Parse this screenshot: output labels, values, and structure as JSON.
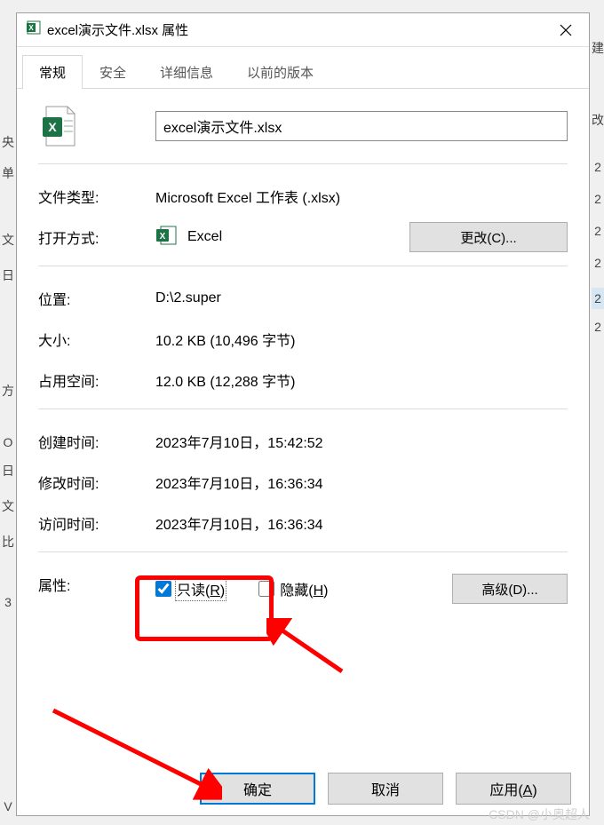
{
  "titlebar": {
    "title": "excel演示文件.xlsx 属性"
  },
  "tabs": {
    "general": "常规",
    "security": "安全",
    "details": "详细信息",
    "previous": "以前的版本"
  },
  "general": {
    "filename": "excel演示文件.xlsx",
    "filetype_label": "文件类型:",
    "filetype_value": "Microsoft Excel 工作表 (.xlsx)",
    "openwith_label": "打开方式:",
    "openwith_app": "Excel",
    "change_btn": "更改(C)...",
    "location_label": "位置:",
    "location_value": "D:\\2.super",
    "size_label": "大小:",
    "size_value": "10.2 KB (10,496 字节)",
    "sizeondisk_label": "占用空间:",
    "sizeondisk_value": "12.0 KB (12,288 字节)",
    "created_label": "创建时间:",
    "created_value": "2023年7月10日，15:42:52",
    "modified_label": "修改时间:",
    "modified_value": "2023年7月10日，16:36:34",
    "accessed_label": "访问时间:",
    "accessed_value": "2023年7月10日，16:36:34",
    "attrs_label": "属性:",
    "readonly_text": "只读(",
    "readonly_key": "R",
    "readonly_close": ")",
    "hidden_text": "隐藏(",
    "hidden_key": "H",
    "hidden_close": ")",
    "advanced_btn": "高级(D)..."
  },
  "footer": {
    "ok": "确定",
    "cancel": "取消",
    "apply_text": "应用(",
    "apply_key": "A",
    "apply_close": ")"
  },
  "watermark": "CSDN @小奥超人"
}
